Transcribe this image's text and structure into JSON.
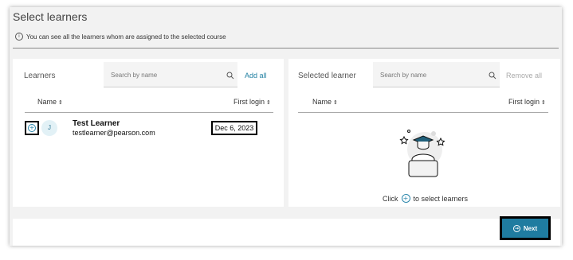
{
  "dialog": {
    "title": "Select learners",
    "info": "You can see all the learners whom are assigned to the selected course"
  },
  "learners_panel": {
    "title": "Learners",
    "search_placeholder": "Search by name",
    "add_all": "Add all",
    "columns": {
      "name": "Name",
      "first_login": "First login"
    },
    "rows": [
      {
        "initial": "J",
        "name": "Test Learner",
        "email": "testlearner@pearson.com",
        "first_login": "Dec 6, 2023"
      }
    ]
  },
  "selected_panel": {
    "title": "Selected learner",
    "search_placeholder": "Search by name",
    "remove_all": "Remove all",
    "columns": {
      "name": "Name",
      "first_login": "First login"
    },
    "empty_prefix": "Click",
    "empty_suffix": "to select learners"
  },
  "footer": {
    "next": "Next"
  },
  "colors": {
    "accent": "#1f7ca0",
    "link": "#1f7fa1",
    "disabled": "#aaaaaa"
  },
  "icons": {
    "info": "info-icon",
    "search": "search-icon",
    "add": "add-circle-icon",
    "next": "arrow-right-circle-icon"
  }
}
